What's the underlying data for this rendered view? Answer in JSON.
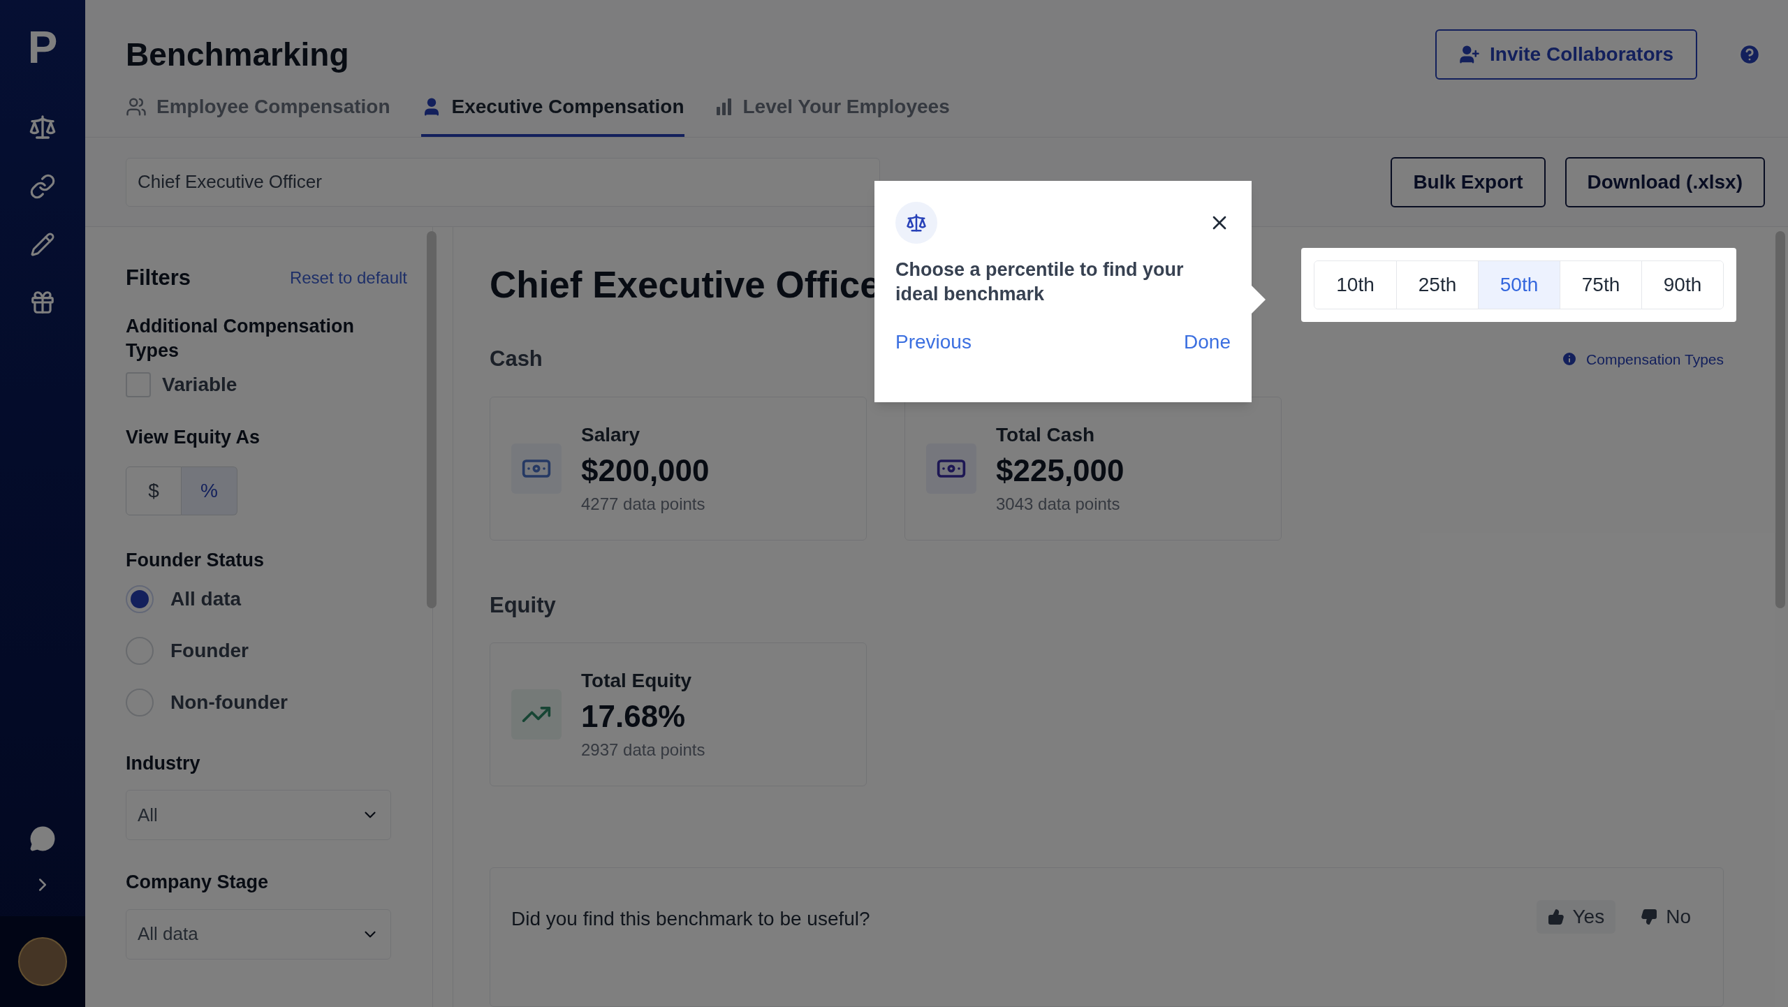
{
  "sidebar": {
    "logo": "P"
  },
  "header": {
    "title": "Benchmarking",
    "invite_button": "Invite Collaborators"
  },
  "tabs": [
    {
      "label": "Employee Compensation",
      "selected": false,
      "kind": "group"
    },
    {
      "label": "Executive Compensation",
      "selected": true,
      "kind": "person"
    },
    {
      "label": "Level Your Employees",
      "selected": false,
      "kind": "bars"
    }
  ],
  "search": {
    "value": "Chief Executive Officer"
  },
  "actions": [
    "Bulk Export",
    "Download (.xlsx)"
  ],
  "filters": {
    "title": "Filters",
    "reset": "Reset to default",
    "additional_title": "Additional Compensation Types",
    "checkboxes": [
      {
        "label": "Variable",
        "checked": false
      }
    ],
    "equity_title": "View Equity As",
    "equity_options": [
      {
        "label": "$",
        "selected": false
      },
      {
        "label": "%",
        "selected": true
      }
    ],
    "founder_title": "Founder Status",
    "founder_options": [
      {
        "label": "All data",
        "selected": true
      },
      {
        "label": "Founder",
        "selected": false
      },
      {
        "label": "Non-founder",
        "selected": false
      }
    ],
    "selects": [
      {
        "label": "Industry",
        "value": "All"
      },
      {
        "label": "Company Stage",
        "value": "All data"
      }
    ]
  },
  "main": {
    "title": "Chief Executive Office",
    "compensation_types_link": "Compensation Types",
    "percentiles": [
      {
        "label": "10th",
        "selected": false
      },
      {
        "label": "25th",
        "selected": false
      },
      {
        "label": "50th",
        "selected": true
      },
      {
        "label": "75th",
        "selected": false
      },
      {
        "label": "90th",
        "selected": false
      }
    ],
    "sections": [
      {
        "title": "Cash",
        "cards": [
          {
            "kind": "salary",
            "label": "Salary",
            "value": "$200,000",
            "data_points": "4277 data points"
          },
          {
            "kind": "cash",
            "label": "Total Cash",
            "value": "$225,000",
            "data_points": "3043 data points"
          }
        ]
      },
      {
        "title": "Equity",
        "cards": [
          {
            "kind": "equity",
            "label": "Total Equity",
            "value": "17.68%",
            "data_points": "2937 data points"
          }
        ]
      }
    ],
    "feedback": {
      "question": "Did you find this benchmark to be useful?",
      "yes": "Yes",
      "no": "No"
    }
  },
  "tour": {
    "text": "Choose a percentile to find your ideal benchmark",
    "previous": "Previous",
    "done": "Done"
  }
}
